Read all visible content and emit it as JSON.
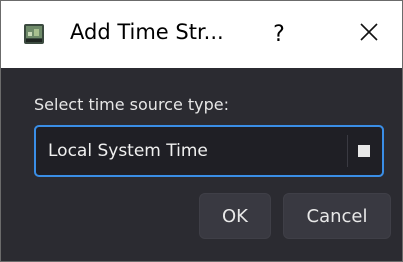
{
  "window": {
    "title": "Add Time Str...",
    "help_label": "?",
    "icons": {
      "app": "monitor-icon",
      "close": "close-icon"
    }
  },
  "form": {
    "prompt": "Select time source type:",
    "source_type": "Local System Time"
  },
  "buttons": {
    "ok": "OK",
    "cancel": "Cancel"
  },
  "colors": {
    "titlebar": "#ffffff",
    "body": "#2b2b31",
    "accent": "#3a8ee6",
    "button": "#393941"
  }
}
